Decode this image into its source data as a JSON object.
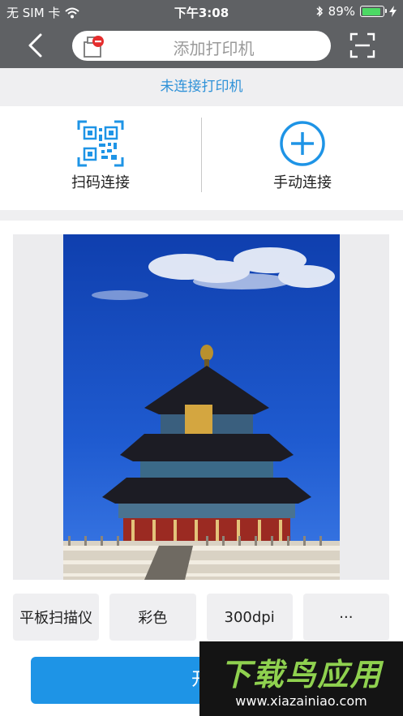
{
  "status_bar": {
    "carrier": "无 SIM 卡",
    "time": "下午3:08",
    "battery_percent": "89%",
    "battery_level": 0.89,
    "icons": [
      "wifi-icon",
      "bluetooth-icon",
      "battery-icon",
      "charging-icon"
    ]
  },
  "navbar": {
    "back_icon": "chevron-left-icon",
    "search_placeholder": "添加打印机",
    "printer_icon": "printer-disconnected-icon",
    "scan_icon": "scan-frame-icon"
  },
  "status_text": "未连接打印机",
  "connect": {
    "qr_label": "扫码连接",
    "qr_icon": "qr-code-icon",
    "manual_label": "手动连接",
    "manual_icon": "plus-circle-icon"
  },
  "preview": {
    "subject": "photo-temple"
  },
  "options": {
    "scanner": "平板扫描仪",
    "color": "彩色",
    "dpi": "300dpi",
    "more": "···"
  },
  "start_button": "开始",
  "watermark": {
    "title": "下载鸟应用",
    "url": "www.xiazainiao.com"
  },
  "colors": {
    "header_gray": "#5f6164",
    "accent_blue": "#2f92d8",
    "button_blue": "#1e94e6",
    "sky_blue": "#1f55c8",
    "watermark_green": "#8fd14f"
  }
}
